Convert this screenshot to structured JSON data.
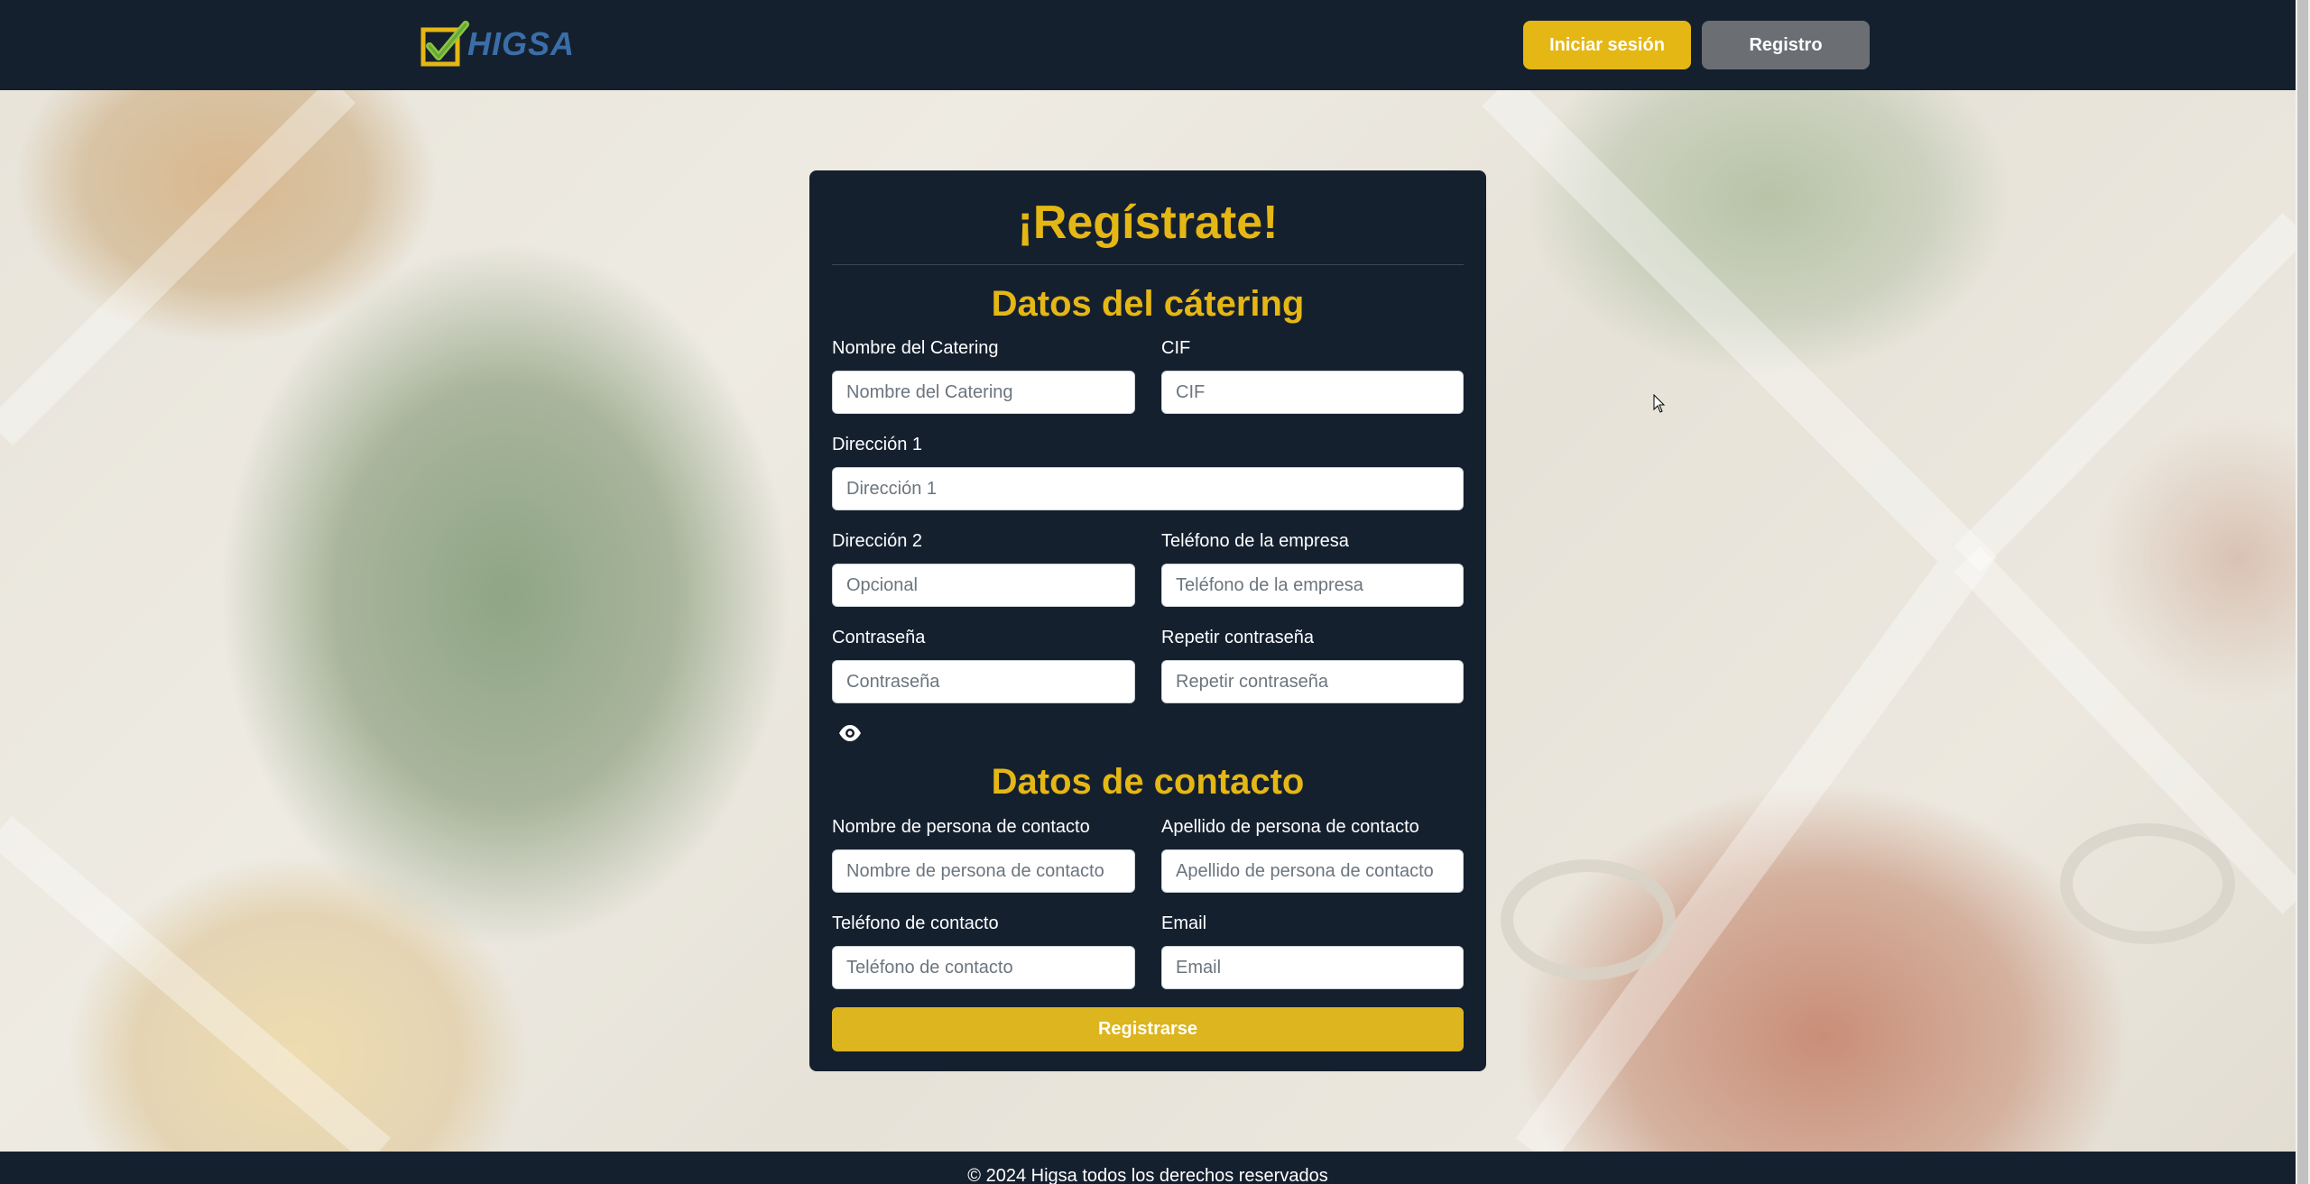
{
  "navbar": {
    "logo_text": "HIGSA",
    "login_label": "Iniciar sesión",
    "register_label": "Registro"
  },
  "form": {
    "title": "¡Regístrate!",
    "section1_title": "Datos del cátering",
    "section2_title": "Datos de contacto",
    "fields": {
      "catering_name": {
        "label": "Nombre del Catering",
        "placeholder": "Nombre del Catering"
      },
      "cif": {
        "label": "CIF",
        "placeholder": "CIF"
      },
      "address1": {
        "label": "Dirección 1",
        "placeholder": "Dirección 1"
      },
      "address2": {
        "label": "Dirección 2",
        "placeholder": "Opcional"
      },
      "company_phone": {
        "label": "Teléfono de la empresa",
        "placeholder": "Teléfono de la empresa"
      },
      "password": {
        "label": "Contraseña",
        "placeholder": "Contraseña"
      },
      "repeat_password": {
        "label": "Repetir contraseña",
        "placeholder": "Repetir contraseña"
      },
      "contact_name": {
        "label": "Nombre de persona de contacto",
        "placeholder": "Nombre de persona de contacto"
      },
      "contact_surname": {
        "label": "Apellido de persona de contacto",
        "placeholder": "Apellido de persona de contacto"
      },
      "contact_phone": {
        "label": "Teléfono de contacto",
        "placeholder": "Teléfono de contacto"
      },
      "email": {
        "label": "Email",
        "placeholder": "Email"
      }
    },
    "submit_label": "Registrarse"
  },
  "footer": {
    "text": "© 2024 Higsa todos los derechos reservados"
  },
  "colors": {
    "navy": "#15202f",
    "accent_yellow": "#e5b714",
    "gray_button": "#6b6f74"
  }
}
